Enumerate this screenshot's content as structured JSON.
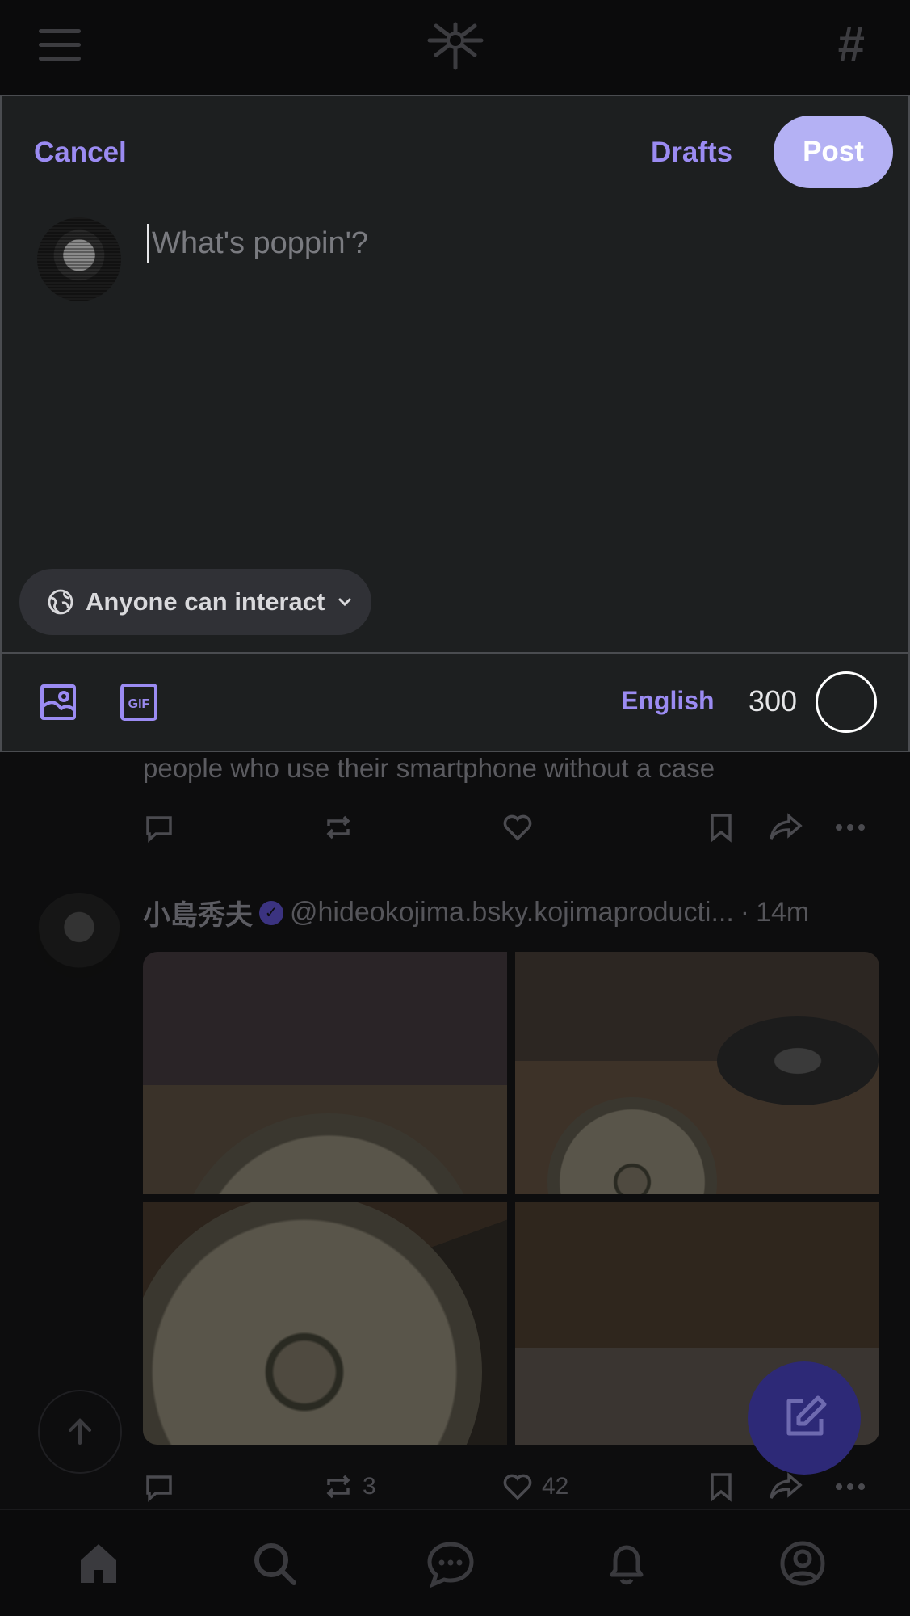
{
  "composer": {
    "cancel_label": "Cancel",
    "drafts_label": "Drafts",
    "post_label": "Post",
    "input_placeholder": "What's poppin'?",
    "input_value": "",
    "interaction_setting": "Anyone can interact",
    "language": "English",
    "chars_remaining": "300"
  },
  "feed": {
    "post1": {
      "text": "people who use their smartphone without a case"
    },
    "post2": {
      "author_name": "小島秀夫",
      "handle": "@hideokojima.bsky.kojimaproducti...",
      "separator": "·",
      "time": "14m",
      "repost_count": "3",
      "like_count": "42"
    }
  },
  "colors": {
    "accent": "#9b8bf2",
    "post_button": "#b4b1f4",
    "modal_bg": "#1d1f20",
    "fab": "#2d2977"
  },
  "icons": {
    "header": [
      "menu-icon",
      "butterfly-logo-icon",
      "hashtag-icon"
    ],
    "toolbar": [
      "image-icon",
      "gif-icon"
    ],
    "tabs": [
      "home-icon",
      "search-icon",
      "chat-icon",
      "bell-icon",
      "profile-icon"
    ]
  }
}
